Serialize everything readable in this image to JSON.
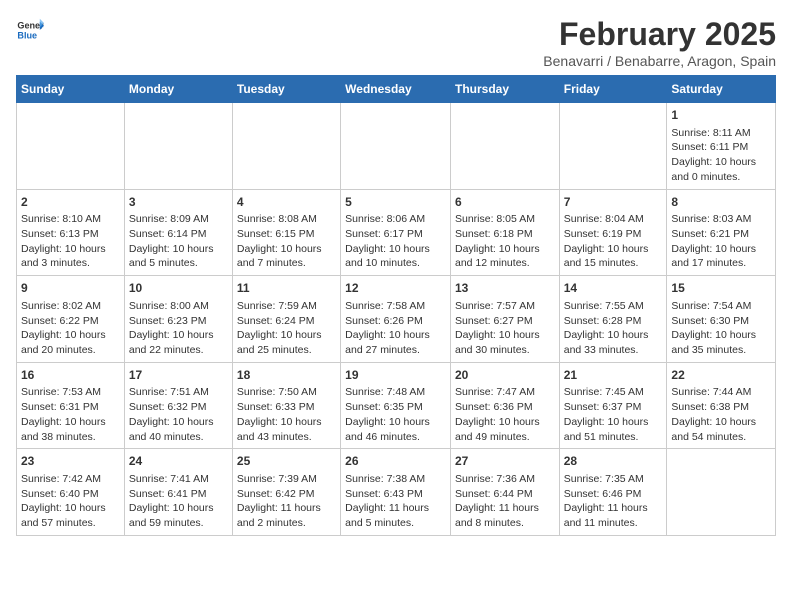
{
  "header": {
    "logo_general": "General",
    "logo_blue": "Blue",
    "title": "February 2025",
    "subtitle": "Benavarri / Benabarre, Aragon, Spain"
  },
  "columns": [
    "Sunday",
    "Monday",
    "Tuesday",
    "Wednesday",
    "Thursday",
    "Friday",
    "Saturday"
  ],
  "weeks": [
    [
      {
        "day": "",
        "info": ""
      },
      {
        "day": "",
        "info": ""
      },
      {
        "day": "",
        "info": ""
      },
      {
        "day": "",
        "info": ""
      },
      {
        "day": "",
        "info": ""
      },
      {
        "day": "",
        "info": ""
      },
      {
        "day": "1",
        "info": "Sunrise: 8:11 AM\nSunset: 6:11 PM\nDaylight: 10 hours and 0 minutes."
      }
    ],
    [
      {
        "day": "2",
        "info": "Sunrise: 8:10 AM\nSunset: 6:13 PM\nDaylight: 10 hours and 3 minutes."
      },
      {
        "day": "3",
        "info": "Sunrise: 8:09 AM\nSunset: 6:14 PM\nDaylight: 10 hours and 5 minutes."
      },
      {
        "day": "4",
        "info": "Sunrise: 8:08 AM\nSunset: 6:15 PM\nDaylight: 10 hours and 7 minutes."
      },
      {
        "day": "5",
        "info": "Sunrise: 8:06 AM\nSunset: 6:17 PM\nDaylight: 10 hours and 10 minutes."
      },
      {
        "day": "6",
        "info": "Sunrise: 8:05 AM\nSunset: 6:18 PM\nDaylight: 10 hours and 12 minutes."
      },
      {
        "day": "7",
        "info": "Sunrise: 8:04 AM\nSunset: 6:19 PM\nDaylight: 10 hours and 15 minutes."
      },
      {
        "day": "8",
        "info": "Sunrise: 8:03 AM\nSunset: 6:21 PM\nDaylight: 10 hours and 17 minutes."
      }
    ],
    [
      {
        "day": "9",
        "info": "Sunrise: 8:02 AM\nSunset: 6:22 PM\nDaylight: 10 hours and 20 minutes."
      },
      {
        "day": "10",
        "info": "Sunrise: 8:00 AM\nSunset: 6:23 PM\nDaylight: 10 hours and 22 minutes."
      },
      {
        "day": "11",
        "info": "Sunrise: 7:59 AM\nSunset: 6:24 PM\nDaylight: 10 hours and 25 minutes."
      },
      {
        "day": "12",
        "info": "Sunrise: 7:58 AM\nSunset: 6:26 PM\nDaylight: 10 hours and 27 minutes."
      },
      {
        "day": "13",
        "info": "Sunrise: 7:57 AM\nSunset: 6:27 PM\nDaylight: 10 hours and 30 minutes."
      },
      {
        "day": "14",
        "info": "Sunrise: 7:55 AM\nSunset: 6:28 PM\nDaylight: 10 hours and 33 minutes."
      },
      {
        "day": "15",
        "info": "Sunrise: 7:54 AM\nSunset: 6:30 PM\nDaylight: 10 hours and 35 minutes."
      }
    ],
    [
      {
        "day": "16",
        "info": "Sunrise: 7:53 AM\nSunset: 6:31 PM\nDaylight: 10 hours and 38 minutes."
      },
      {
        "day": "17",
        "info": "Sunrise: 7:51 AM\nSunset: 6:32 PM\nDaylight: 10 hours and 40 minutes."
      },
      {
        "day": "18",
        "info": "Sunrise: 7:50 AM\nSunset: 6:33 PM\nDaylight: 10 hours and 43 minutes."
      },
      {
        "day": "19",
        "info": "Sunrise: 7:48 AM\nSunset: 6:35 PM\nDaylight: 10 hours and 46 minutes."
      },
      {
        "day": "20",
        "info": "Sunrise: 7:47 AM\nSunset: 6:36 PM\nDaylight: 10 hours and 49 minutes."
      },
      {
        "day": "21",
        "info": "Sunrise: 7:45 AM\nSunset: 6:37 PM\nDaylight: 10 hours and 51 minutes."
      },
      {
        "day": "22",
        "info": "Sunrise: 7:44 AM\nSunset: 6:38 PM\nDaylight: 10 hours and 54 minutes."
      }
    ],
    [
      {
        "day": "23",
        "info": "Sunrise: 7:42 AM\nSunset: 6:40 PM\nDaylight: 10 hours and 57 minutes."
      },
      {
        "day": "24",
        "info": "Sunrise: 7:41 AM\nSunset: 6:41 PM\nDaylight: 10 hours and 59 minutes."
      },
      {
        "day": "25",
        "info": "Sunrise: 7:39 AM\nSunset: 6:42 PM\nDaylight: 11 hours and 2 minutes."
      },
      {
        "day": "26",
        "info": "Sunrise: 7:38 AM\nSunset: 6:43 PM\nDaylight: 11 hours and 5 minutes."
      },
      {
        "day": "27",
        "info": "Sunrise: 7:36 AM\nSunset: 6:44 PM\nDaylight: 11 hours and 8 minutes."
      },
      {
        "day": "28",
        "info": "Sunrise: 7:35 AM\nSunset: 6:46 PM\nDaylight: 11 hours and 11 minutes."
      },
      {
        "day": "",
        "info": ""
      }
    ]
  ]
}
